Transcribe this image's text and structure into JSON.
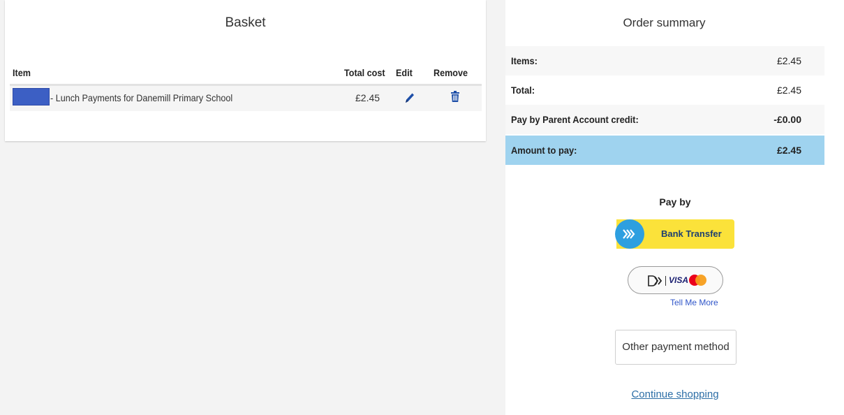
{
  "basket": {
    "title": "Basket",
    "columns": {
      "item": "Item",
      "total_cost": "Total cost",
      "edit": "Edit",
      "remove": "Remove"
    },
    "rows": [
      {
        "item": "- Lunch Payments for Danemill Primary School",
        "total_cost": "£2.45",
        "edit_icon": "pencil-icon",
        "remove_icon": "trash-icon"
      }
    ]
  },
  "summary": {
    "title": "Order summary",
    "rows": [
      {
        "label": "Items:",
        "value": "£2.45"
      },
      {
        "label": "Total:",
        "value": "£2.45"
      },
      {
        "label": "Pay by Parent Account credit:",
        "value": "-£0.00"
      },
      {
        "label": "Amount to pay:",
        "value": "£2.45"
      }
    ],
    "highlight_color": "#9fd3ef"
  },
  "payment": {
    "pay_by_label": "Pay by",
    "bank_transfer_label": "Bank Transfer",
    "card_visa_text": "VISA",
    "tell_me_more": "Tell Me More",
    "other_method": "Other payment method",
    "continue_shopping": "Continue shopping",
    "colors": {
      "bank_button": "#fbe23a",
      "bank_circle": "#2d9fe0",
      "link": "#2c6ea6"
    }
  }
}
